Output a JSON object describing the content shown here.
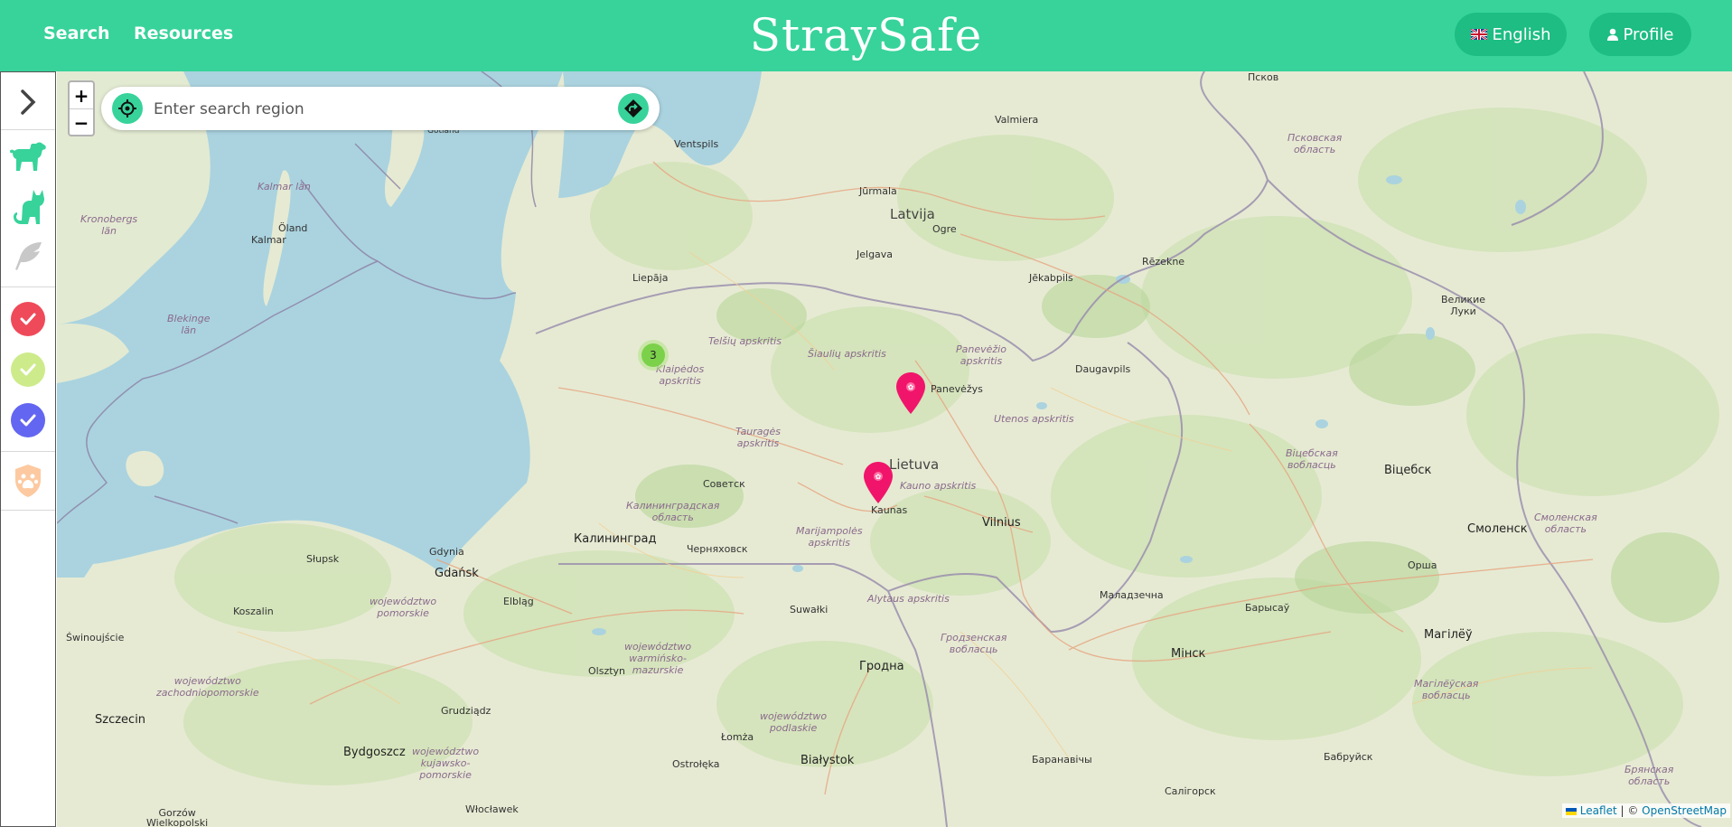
{
  "header": {
    "nav": [
      {
        "label": "Search"
      },
      {
        "label": "Resources"
      }
    ],
    "brand": "StraySafe",
    "language_label": "English",
    "profile_label": "Profile"
  },
  "sidebar": {
    "items": [
      {
        "name": "expand",
        "icon": "chevron-right-icon"
      },
      {
        "name": "dog-filter",
        "icon": "dog-icon",
        "color": "#37d39b"
      },
      {
        "name": "cat-filter",
        "icon": "cat-icon",
        "color": "#37d39b"
      },
      {
        "name": "bird-filter",
        "icon": "feather-icon",
        "color": "#c8c8c8"
      },
      {
        "name": "status-red",
        "icon": "check-icon",
        "color": "#ef4a5a"
      },
      {
        "name": "status-lime",
        "icon": "check-icon",
        "color": "#cdeb8b"
      },
      {
        "name": "status-blue",
        "icon": "check-icon",
        "color": "#6366f1"
      },
      {
        "name": "shelter-filter",
        "icon": "paw-shield-icon",
        "color": "#fdc9a0"
      }
    ]
  },
  "map": {
    "search_placeholder": "Enter search region",
    "cluster_count": "3",
    "attribution": {
      "leaflet": "Leaflet",
      "separator": " | © ",
      "osm": "OpenStreetMap"
    },
    "labels": {
      "pskov": "Псков",
      "valmiera": "Valmiera",
      "pskov_oblast": "Псковская\nобласть",
      "ventspils": "Ventspils",
      "gotland": "Gotland",
      "jurmala": "Jūrmala",
      "latvija": "Latvija",
      "ogre": "Ogre",
      "kalmar_lan": "Kalmar län",
      "kronobergs": "Kronobergs\nlän",
      "oland": "Öland",
      "kalmar": "Kalmar",
      "jelgava": "Jelgava",
      "rezekne": "Rēzekne",
      "jekabpils": "Jēkabpils",
      "liepaja": "Liepāja",
      "velikie_luki": "Великие\nЛуки",
      "blekinge": "Blekinge\nlän",
      "telsiu": "Telšių apskritis",
      "siauliu": "Šiaulių apskritis",
      "panevezio": "Panevėžio\napskritis",
      "daugavpils": "Daugavpils",
      "klaipedos": "Klaipėdos\napskritis",
      "panevezys": "Panevėžys",
      "utenos": "Utenos apskritis",
      "taurages": "Tauragės\napskritis",
      "lietuva": "Lietuva",
      "vitebsk_obl": "Віцебская\nвобласць",
      "vitebsk": "Віцебск",
      "sovetsk": "Советск",
      "kauno": "Kauno apskritis",
      "kaunas": "Kaunas",
      "kaliningrad_obl": "Калининградская\nобласть",
      "vilnius": "Vilnius",
      "smolensk_obl": "Смоленская\nобласть",
      "smolensk": "Смоленск",
      "kaliningrad": "Калининград",
      "marijampoles": "Marijampolės\napskritis",
      "chernyakhovsk": "Черняховск",
      "gdynia": "Gdynia",
      "slupsk": "Słupsk",
      "gdansk": "Gdańsk",
      "orsha": "Орша",
      "pomorskie": "województwo\npomorskie",
      "elblag": "Elbląg",
      "molodechno": "Маладзечна",
      "koszalin": "Koszalin",
      "alytaus": "Alytaus apskritis",
      "suwalki": "Suwałki",
      "barysau": "Барысаў",
      "swinoujscie": "Świnoujście",
      "warminsko": "województwo\nwarmińsko-\nmazurskie",
      "grodno_obl": "Гродзенская\nвобласць",
      "mogilev": "Магілёў",
      "minsk": "Мінск",
      "olsztyn": "Olsztyn",
      "grodno": "Гродна",
      "zachodnio": "województwo\nzachodniopomorskie",
      "mogilev_obl": "Магілёўская\nвобласць",
      "grudziadz": "Grudziądz",
      "podlaskie": "województwo\npodlaskie",
      "szczecin": "Szczecin",
      "lomza": "Łomża",
      "bydgoszcz": "Bydgoszcz",
      "kujawsko": "województwo\nkujawsko-\npomorskie",
      "bialystok": "Białystok",
      "ostroleka": "Ostrołęka",
      "baranovichi": "Баранавічы",
      "babruysk": "Бабруйск",
      "bryansk_obl": "Брянская\nобласть",
      "wloclawek": "Włocławek",
      "soligorsk": "Салігорск",
      "gorzow": "Gorzów\nWielkopolski"
    }
  }
}
